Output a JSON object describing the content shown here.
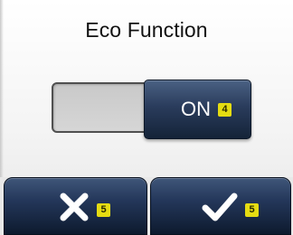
{
  "screen": {
    "title": "Eco Function"
  },
  "toggle": {
    "state_label": "ON",
    "badge": "4",
    "is_on": true
  },
  "buttons": {
    "cancel": {
      "icon": "close-icon",
      "badge": "5"
    },
    "confirm": {
      "icon": "checkmark-icon",
      "badge": "5"
    }
  },
  "colors": {
    "button_blue_top": "#3f5679",
    "button_blue_bottom": "#0d1a2e",
    "badge_yellow": "#e5dc12",
    "track_gray": "#cfcfcf"
  }
}
